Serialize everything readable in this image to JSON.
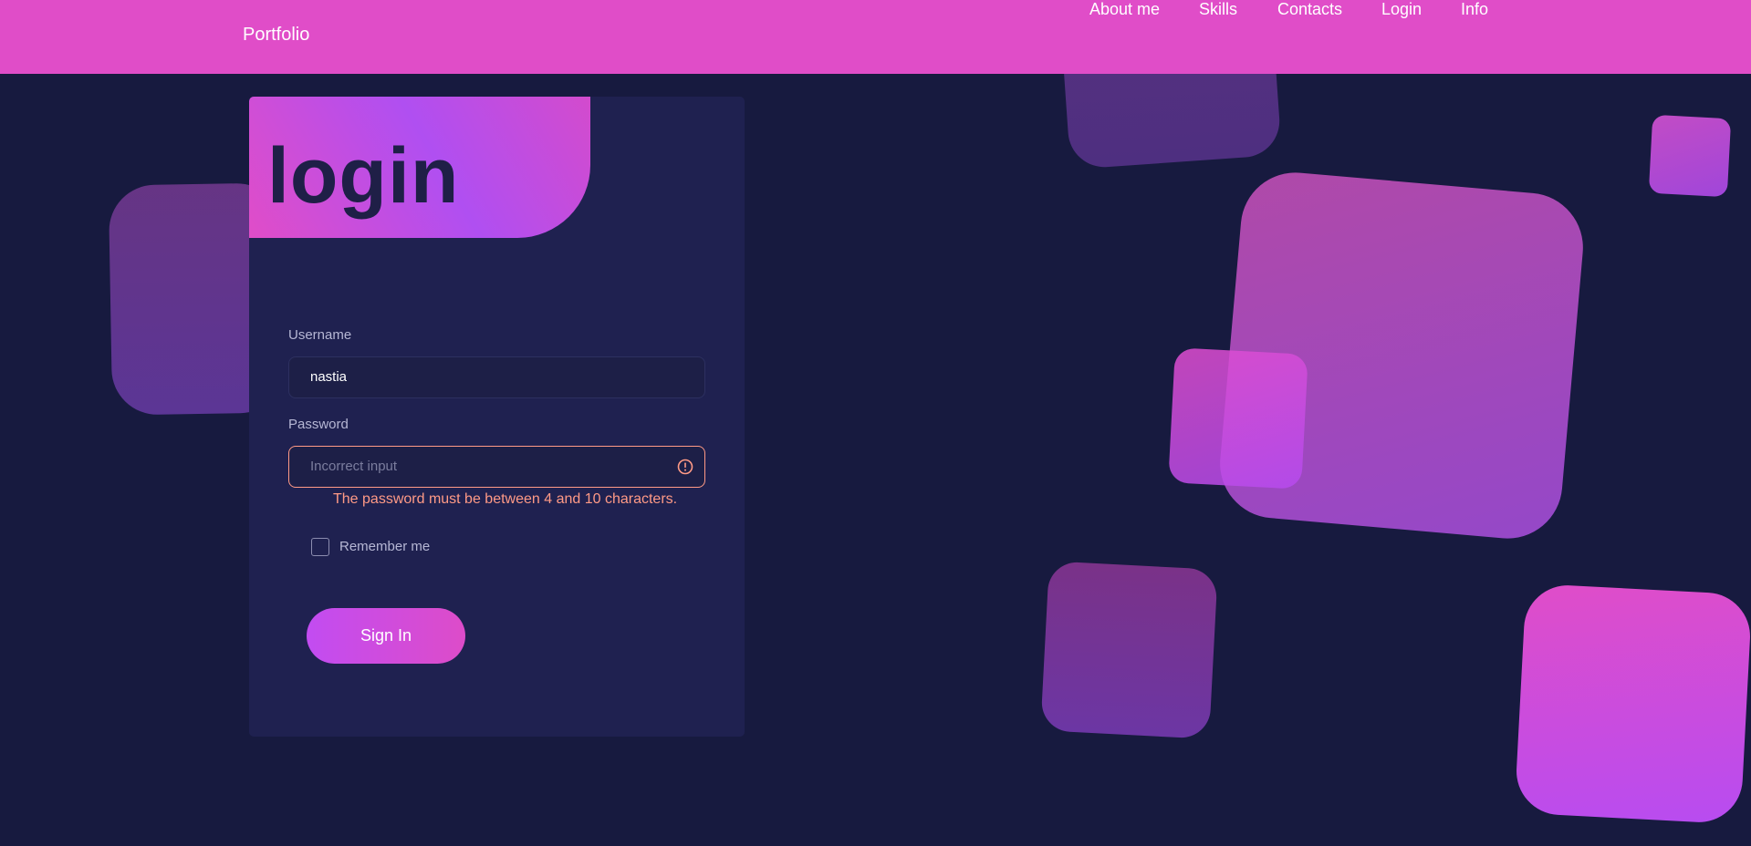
{
  "header": {
    "brand": "Portfolio",
    "nav": [
      "About me",
      "Skills",
      "Contacts",
      "Login",
      "Info"
    ]
  },
  "login": {
    "title": "login",
    "username_label": "Username",
    "username_value": "nastia",
    "password_label": "Password",
    "password_placeholder": "Incorrect input",
    "password_error": "The password must be between 4 and 10 characters.",
    "remember_label": "Remember me",
    "remember_checked": false,
    "submit_label": "Sign In"
  },
  "colors": {
    "background": "#171a3f",
    "header": "#e04dc8",
    "card": "#1f2150",
    "error": "#ff9a86",
    "accent_pink": "#e04dc8",
    "accent_purple": "#b04ff1"
  },
  "icons": {
    "error": "alert-circle-icon"
  }
}
